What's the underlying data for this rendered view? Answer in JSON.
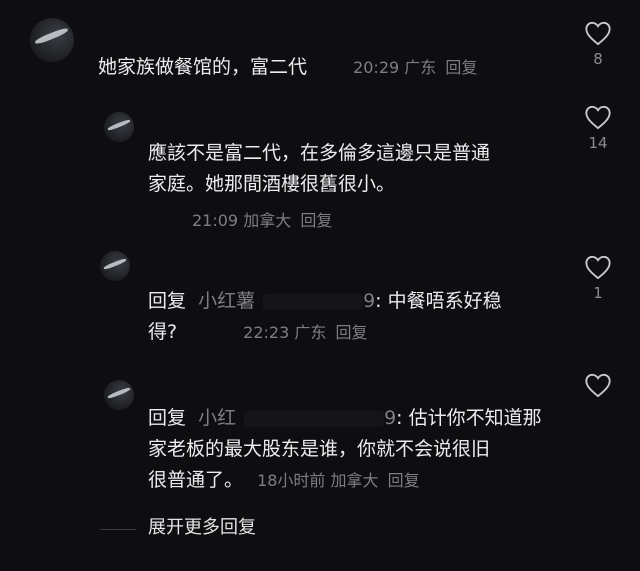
{
  "comments": [
    {
      "text": "她家族做餐馆的，富二代",
      "time": "20:29",
      "location": "广东",
      "reply": "回复",
      "likes": "8"
    },
    {
      "text_line1": "應該不是富二代，在多倫多這邊只是普通",
      "text_line2": "家庭。她那間酒樓很舊很小。",
      "time": "21:09",
      "location": "加拿大",
      "reply": "回复",
      "likes": "14"
    },
    {
      "prefix": "回复",
      "mention": "小红薯",
      "mention_tail": "9",
      "text_line1": ": 中餐唔系好稳",
      "text_line2": "得?",
      "time": "22:23",
      "location": "广东",
      "reply": "回复",
      "likes": "1"
    },
    {
      "prefix": "回复",
      "mention": "小红",
      "mention_tail": "9",
      "text_line1": ": 估计你不知道那",
      "text_line2": "家老板的最大股东是谁，你就不会说很旧",
      "text_line3": "很普通了。",
      "time": "18小时前",
      "location": "加拿大",
      "reply": "回复",
      "likes": ""
    }
  ],
  "expand_label": "展开更多回复",
  "colors": {
    "background": "#0e0e10",
    "text": "#ececef",
    "meta": "#7d7e84"
  }
}
